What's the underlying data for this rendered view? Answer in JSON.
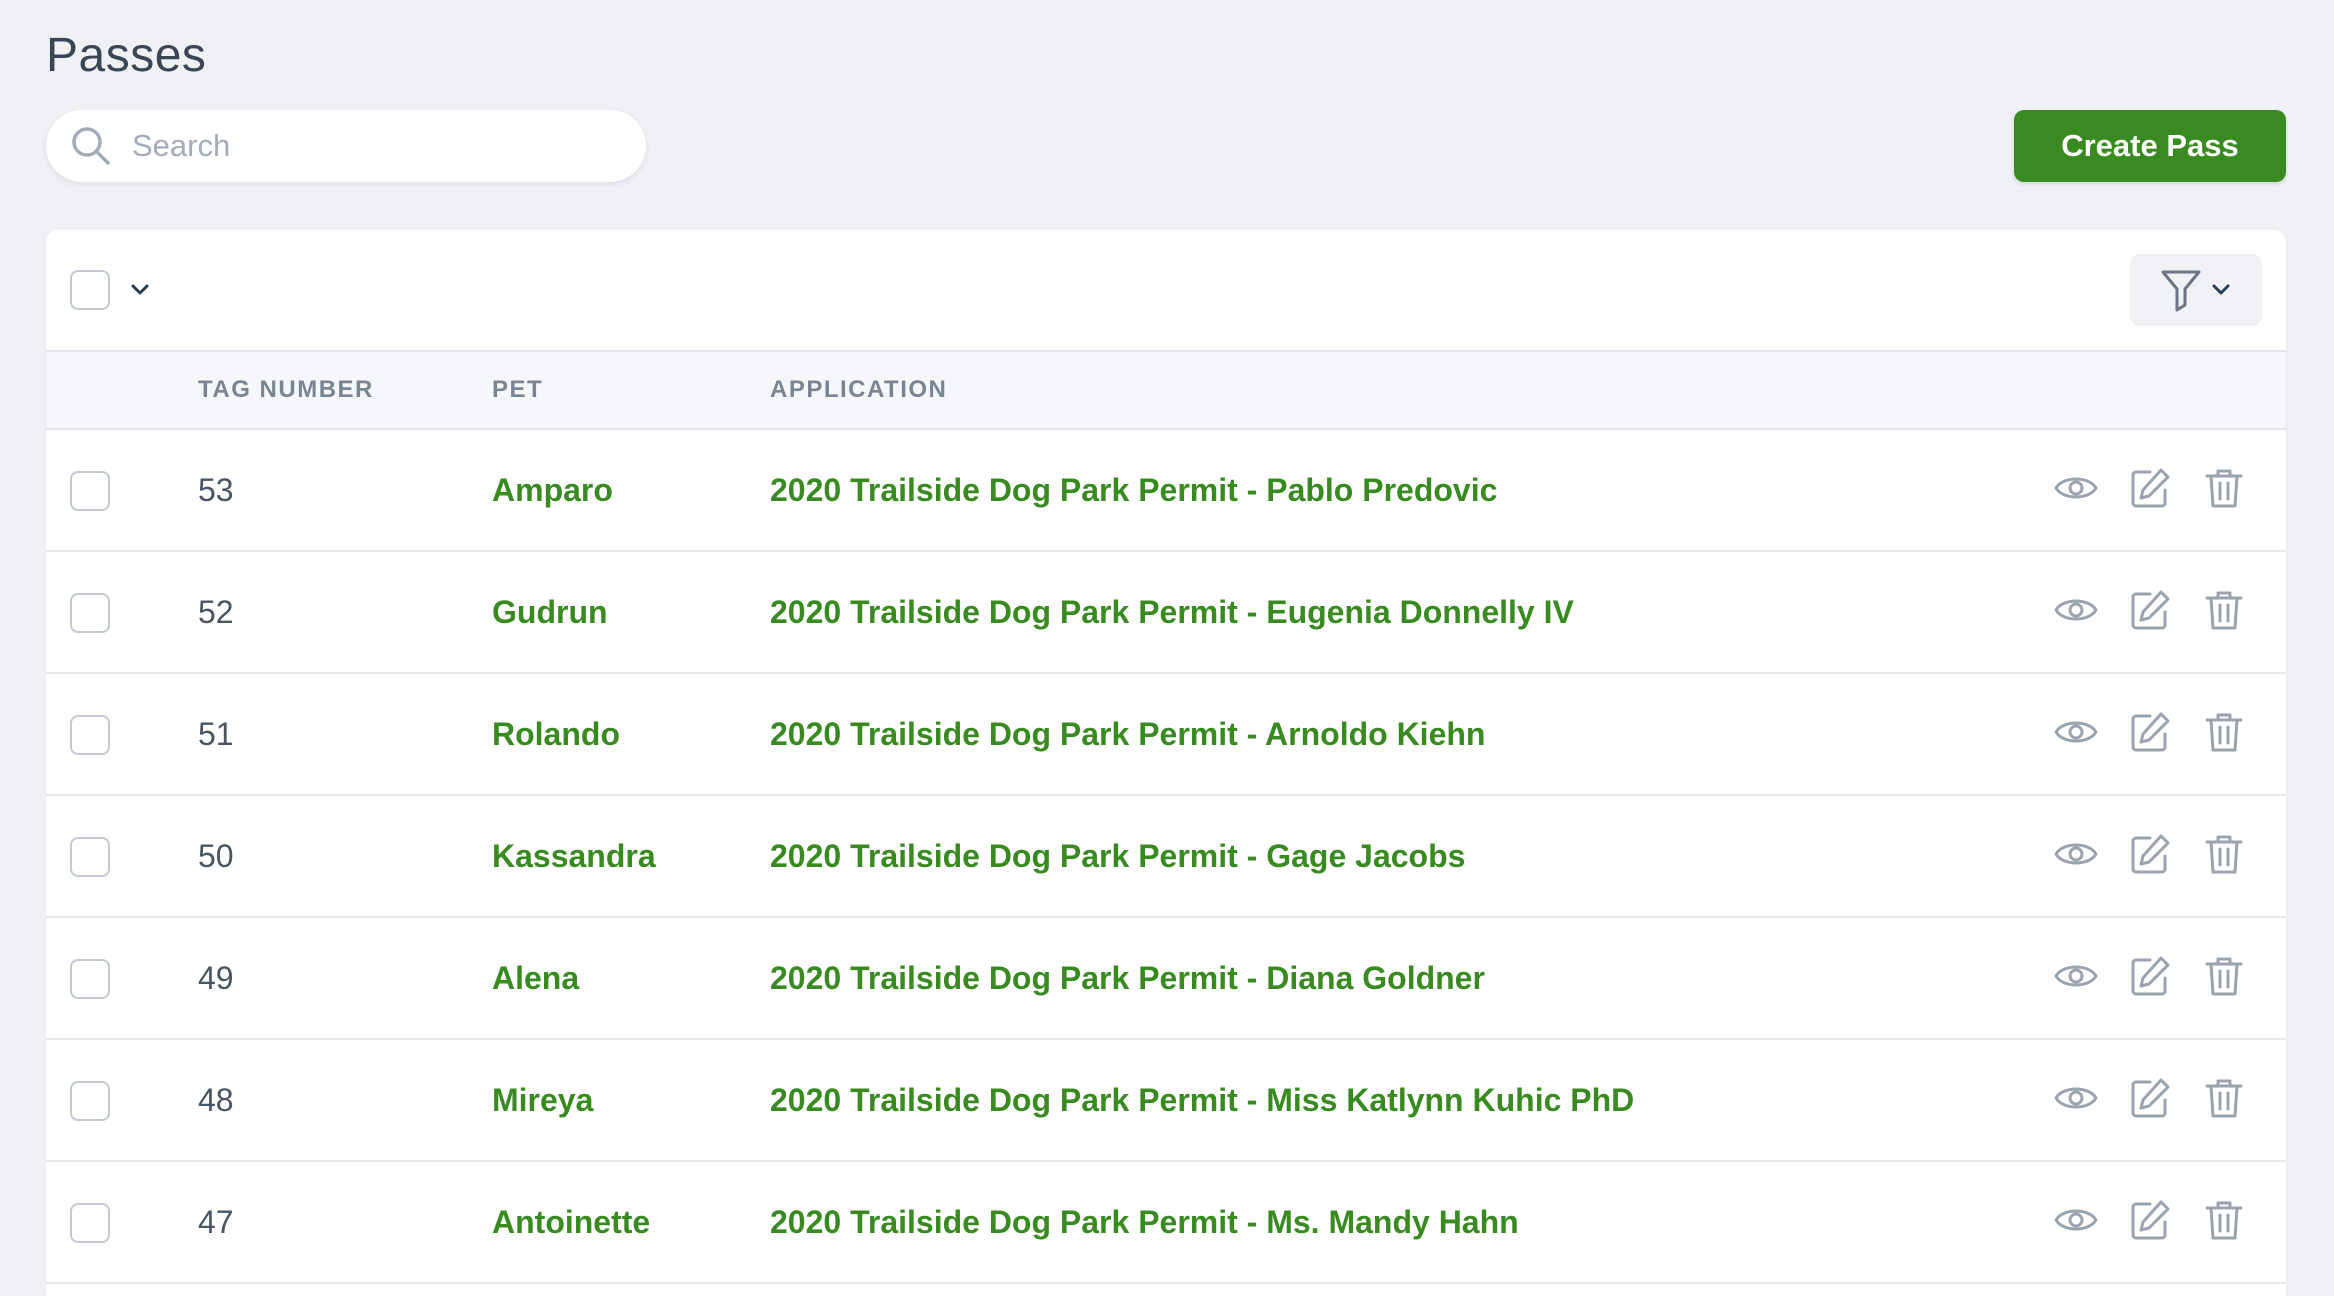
{
  "page": {
    "title": "Passes"
  },
  "search": {
    "placeholder": "Search",
    "value": ""
  },
  "header": {
    "create_label": "Create Pass"
  },
  "table": {
    "columns": [
      "TAG NUMBER",
      "PET",
      "APPLICATION"
    ],
    "rows": [
      {
        "tag": "53",
        "pet": "Amparo",
        "application": "2020 Trailside Dog Park Permit - Pablo Predovic"
      },
      {
        "tag": "52",
        "pet": "Gudrun",
        "application": "2020 Trailside Dog Park Permit - Eugenia Donnelly IV"
      },
      {
        "tag": "51",
        "pet": "Rolando",
        "application": "2020 Trailside Dog Park Permit - Arnoldo Kiehn"
      },
      {
        "tag": "50",
        "pet": "Kassandra",
        "application": "2020 Trailside Dog Park Permit - Gage Jacobs"
      },
      {
        "tag": "49",
        "pet": "Alena",
        "application": "2020 Trailside Dog Park Permit - Diana Goldner"
      },
      {
        "tag": "48",
        "pet": "Mireya",
        "application": "2020 Trailside Dog Park Permit - Miss Katlynn Kuhic PhD"
      },
      {
        "tag": "47",
        "pet": "Antoinette",
        "application": "2020 Trailside Dog Park Permit - Ms. Mandy Hahn"
      }
    ]
  },
  "icons": {
    "search": "search-icon",
    "select_chevron": "chevron-down-icon",
    "filter": "filter-icon",
    "row_actions": [
      "eye-icon",
      "edit-icon",
      "trash-icon"
    ]
  },
  "colors": {
    "accent": "#3a8a22",
    "background": "#f0f1f5",
    "icon_gray": "#9aa3ae"
  }
}
